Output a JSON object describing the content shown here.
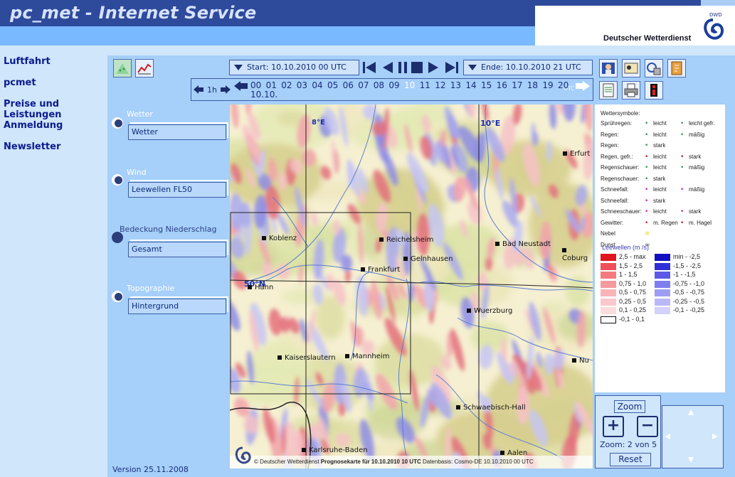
{
  "header": {
    "title": "pc_met - Internet Service",
    "brand": "Deutscher Wetterdienst",
    "logo_text": "DWD"
  },
  "sidebar": {
    "items": [
      {
        "label": "Luftfahrt"
      },
      {
        "label": "pcmet"
      },
      {
        "label": "Preise und Leistungen"
      },
      {
        "label": "Anmeldung"
      },
      {
        "label": "Newsletter"
      }
    ]
  },
  "controls": {
    "start_label": "Start: 10.10.2010 00 UTC",
    "end_label": "Ende: 10.10.2010 21 UTC",
    "step": "1h",
    "hours": [
      "00",
      "01",
      "02",
      "03",
      "04",
      "05",
      "06",
      "07",
      "08",
      "09",
      "10",
      "11",
      "12",
      "13",
      "14",
      "15",
      "16",
      "17",
      "18",
      "19",
      "20"
    ],
    "selected_hour": "10",
    "date_line": "10.10.",
    "overflow_hour": "UTC"
  },
  "layers": [
    {
      "heading": "Wetter",
      "value": "Wetter"
    },
    {
      "heading": "Wind",
      "value": "Leewellen FL50"
    },
    {
      "heading": "Bedeckung  Niederschlag",
      "value": "Gesamt"
    },
    {
      "heading": "Topographie",
      "value": "Hintergrund"
    }
  ],
  "map": {
    "labels": {
      "lon8": "8°E",
      "lon10": "10°E",
      "lat50": "50°N"
    },
    "cities": [
      "Erfurt",
      "Koblenz",
      "Reichelsheim",
      "Bad Neustadt",
      "Coburg",
      "Gelnhausen",
      "Frankfurt",
      "Hahn",
      "Wuerzburg",
      "Kaiserslautern",
      "Mannheim",
      "Nu",
      "Schwaebisch-Hall",
      "Karlsruhe-Baden",
      "Aalen"
    ],
    "footer_pre": "© Deutscher Wetterdienst ",
    "footer_bold": "Prognosekarte für  10.10.2010 10 UTC",
    "footer_post": " Datenbasis: Cosmo-DE 10.10.2010 00 UTC"
  },
  "legend": {
    "symbols_title": "Wettersymbole:",
    "rows": [
      {
        "name": "Sprühregen:",
        "a": "leicht",
        "b": "leicht gefr."
      },
      {
        "name": "Regen:",
        "a": "leicht",
        "b": "mäßig"
      },
      {
        "name": "Regen:",
        "a": "stark",
        "b": ""
      },
      {
        "name": "Regen, gefr.:",
        "a": "leicht",
        "b": "stark"
      },
      {
        "name": "Regenschauer:",
        "a": "leicht",
        "b": "mäßig"
      },
      {
        "name": "Regenschauer:",
        "a": "stark",
        "b": ""
      },
      {
        "name": "Schneefall:",
        "a": "leicht",
        "b": "mäßig"
      },
      {
        "name": "Schneefall:",
        "a": "stark",
        "b": ""
      },
      {
        "name": "Schneeschauer:",
        "a": "leicht",
        "b": "stark"
      },
      {
        "name": "Gewitter:",
        "a": "m. Regen",
        "b": "m. Hagel"
      },
      {
        "name": "Nebel",
        "a": "",
        "b": ""
      },
      {
        "name": "Dunst",
        "a": "",
        "b": ""
      }
    ],
    "lee_title": "Leewellen (m /s)",
    "lee_pos": [
      {
        "label": "2,5 - max",
        "color": "#e0141e"
      },
      {
        "label": "1,5 - 2,5",
        "color": "#f0505a"
      },
      {
        "label": "1 - 1,5",
        "color": "#f47a80"
      },
      {
        "label": "0,75 - 1,0",
        "color": "#f79aa0"
      },
      {
        "label": "0,5 - 0,75",
        "color": "#f9b4b8"
      },
      {
        "label": "0,25 - 0,5",
        "color": "#fbc8cb"
      },
      {
        "label": "0,1 - 0,25",
        "color": "#fddcde"
      },
      {
        "label": "-0,1 - 0,1",
        "color": "#ffffff"
      }
    ],
    "lee_neg": [
      {
        "label": "min - -2,5",
        "color": "#1010c0"
      },
      {
        "label": "-1,5 - -2,5",
        "color": "#3030d8"
      },
      {
        "label": "-1 - -1,5",
        "color": "#5a5ae6"
      },
      {
        "label": "-0,75 - -1,0",
        "color": "#7e7eef"
      },
      {
        "label": "-0,5 - -0,75",
        "color": "#9d9df4"
      },
      {
        "label": "-0,25 - -0,5",
        "color": "#b9b9f8"
      },
      {
        "label": "-0,1 - -0,25",
        "color": "#d2d2fb"
      }
    ]
  },
  "zoom": {
    "title": "Zoom",
    "status": "Zoom: 2 von 5",
    "reset": "Reset",
    "plus": "+",
    "minus": "−"
  },
  "version": "Version 25.11.2008"
}
